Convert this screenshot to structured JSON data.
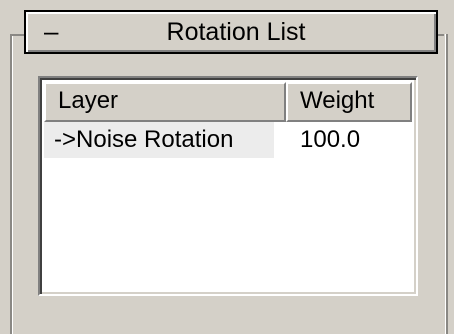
{
  "rollout": {
    "collapse_glyph": "–",
    "title": "Rotation List"
  },
  "list": {
    "columns": [
      "Layer",
      "Weight"
    ],
    "rows": [
      {
        "layer": "->Noise Rotation",
        "weight": "100.0"
      }
    ]
  }
}
